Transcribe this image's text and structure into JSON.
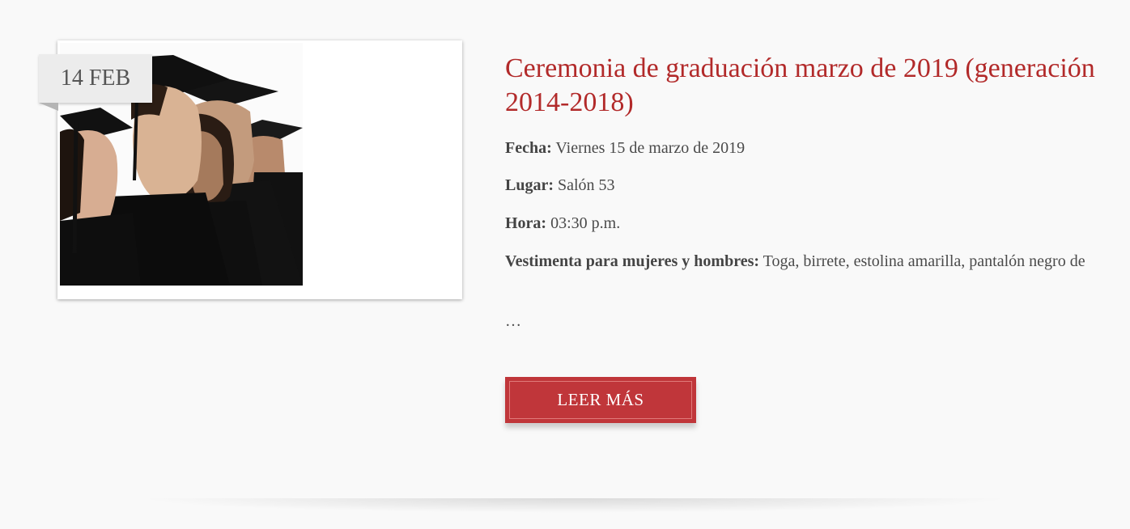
{
  "event": {
    "date_badge": "14 FEB",
    "image_alt": "graduates-photo",
    "title": "Ceremonia de graduación marzo de 2019 (generación 2014-2018)",
    "fecha_label": "Fecha:",
    "fecha_value": " Viernes 15 de marzo de 2019",
    "lugar_label": "Lugar:",
    "lugar_value": " Salón 53",
    "hora_label": "Hora:",
    "hora_value": " 03:30 p.m.",
    "vestimenta_label": "Vestimenta para mujeres y hombres:",
    "vestimenta_value": " Toga, birrete, estolina amarilla, pantalón negro de",
    "ellipsis": "…",
    "button_label": "LEER MÁS"
  },
  "colors": {
    "title": "#b22a2a",
    "button": "#c0363a",
    "background": "#f9f9f9"
  }
}
